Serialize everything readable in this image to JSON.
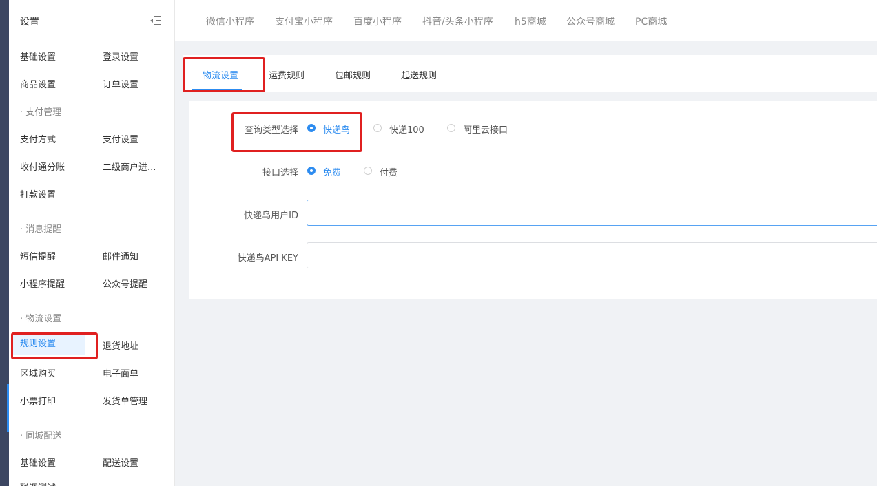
{
  "sidebar": {
    "title": "设置",
    "collapse_icon": "menu-fold-icon",
    "groups": [
      {
        "label": "",
        "items": [
          "基础设置",
          "登录设置",
          "商品设置",
          "订单设置"
        ]
      },
      {
        "label": "· 支付管理",
        "items": [
          "支付方式",
          "支付设置",
          "收付通分账",
          "二级商户进...",
          "打款设置"
        ]
      },
      {
        "label": "· 消息提醒",
        "items": [
          "短信提醒",
          "邮件通知",
          "小程序提醒",
          "公众号提醒"
        ]
      },
      {
        "label": "· 物流设置",
        "items": [
          "规则设置",
          "退货地址",
          "区域购买",
          "电子面单",
          "小票打印",
          "发货单管理"
        ]
      },
      {
        "label": "· 同城配送",
        "items": [
          "基础设置",
          "配送设置",
          "联调测试"
        ]
      }
    ],
    "active_item": "规则设置"
  },
  "topnav": {
    "items": [
      "微信小程序",
      "支付宝小程序",
      "百度小程序",
      "抖音/头条小程序",
      "h5商城",
      "公众号商城",
      "PC商城"
    ]
  },
  "tabs": {
    "items": [
      "物流设置",
      "运费规则",
      "包邮规则",
      "起送规则"
    ],
    "active": "物流设置"
  },
  "form": {
    "query_type": {
      "label": "查询类型选择",
      "options": [
        "快递鸟",
        "快递100",
        "阿里云接口"
      ],
      "selected": "快递鸟"
    },
    "api_select": {
      "label": "接口选择",
      "options": [
        "免费",
        "付费"
      ],
      "selected": "免费"
    },
    "user_id": {
      "label": "快递鸟用户ID",
      "value": ""
    },
    "api_key": {
      "label": "快递鸟API KEY",
      "value": ""
    }
  },
  "colors": {
    "accent": "#2d8cf0",
    "highlight_box": "#e02020",
    "dark_rail": "#3c4661",
    "page_bg": "#f0f2f5"
  }
}
